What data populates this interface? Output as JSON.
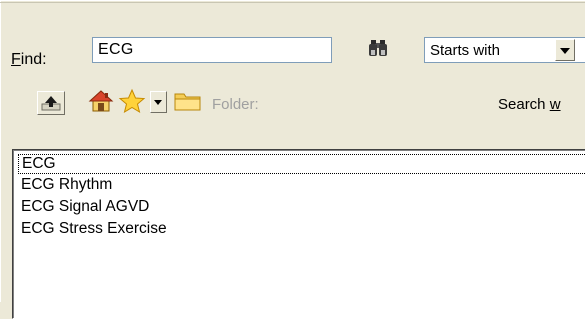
{
  "find": {
    "label_prefix": "",
    "label_accel": "F",
    "label_rest": "ind:",
    "value": "ECG"
  },
  "match_mode": {
    "selected": "Starts with"
  },
  "toolbar": {
    "folder_label": "Folder:",
    "search_prefix": "Search ",
    "search_accel": "w"
  },
  "results": {
    "items": [
      {
        "label": "ECG"
      },
      {
        "label": "ECG Rhythm"
      },
      {
        "label": "ECG Signal AGVD"
      },
      {
        "label": "ECG Stress Exercise"
      }
    ]
  },
  "icons": {
    "binoculars": "binoculars-icon",
    "up": "up-one-level-icon",
    "home": "home-icon",
    "favorites": "favorites-star-icon",
    "folder": "folder-icon"
  }
}
